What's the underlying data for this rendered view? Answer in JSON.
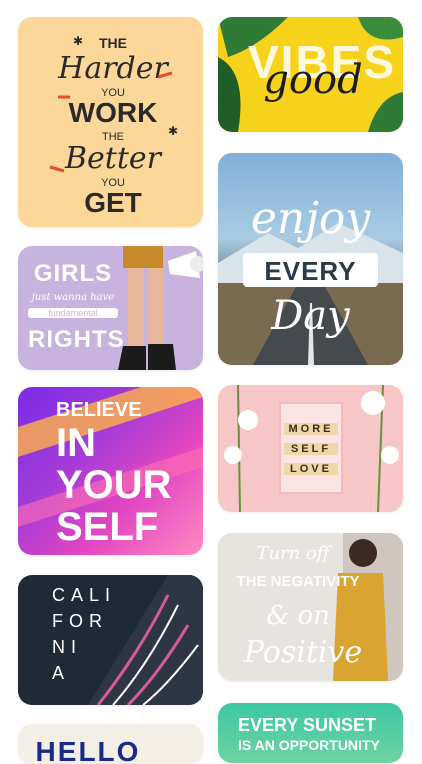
{
  "cards": {
    "hard_work": {
      "line1": "THE",
      "line2": "Harder",
      "line3": "YOU",
      "line4": "WORK",
      "line5": "THE",
      "line6": "Better",
      "line7": "YOU",
      "line8": "GET"
    },
    "good_vibes": {
      "line1": "VIBES",
      "line2": "good"
    },
    "girls_rights": {
      "line1": "GIRLS",
      "line2": "just wanna have",
      "line3": "fundamental",
      "line4": "RIGHTS"
    },
    "enjoy_every_day": {
      "line1": "enjoy",
      "line2": "EVERY",
      "line3": "Day"
    },
    "believe_in_yourself": {
      "line1": "BELIEVE",
      "line2": "IN",
      "line3": "YOUR",
      "line4": "SELF"
    },
    "more_self_love": {
      "line1": "MORE",
      "line2": "SELF",
      "line3": "LOVE"
    },
    "california": {
      "line1": "CALI",
      "line2": "FOR",
      "line3": "NI",
      "line4": "A"
    },
    "turn_off_negativity": {
      "line1": "Turn off",
      "line2": "THE NEGATIVITY",
      "line3": "& on",
      "line4": "Positive"
    },
    "partial_bottom_left": {
      "line1": "HELLO"
    },
    "every_sunset": {
      "line1": "EVERY SUNSET",
      "line2": "IS AN OPPORTUNITY"
    }
  },
  "colors": {
    "page_bg": "#ffffff",
    "card_hard_work": "#fbd79a",
    "card_good_vibes": "#f6d31a",
    "card_girls": "#c8b2de",
    "card_believe": "#a23bd8",
    "card_self_love": "#f7c6c6",
    "card_california": "#1f2a36",
    "card_sunset": "#3cc7a6"
  }
}
